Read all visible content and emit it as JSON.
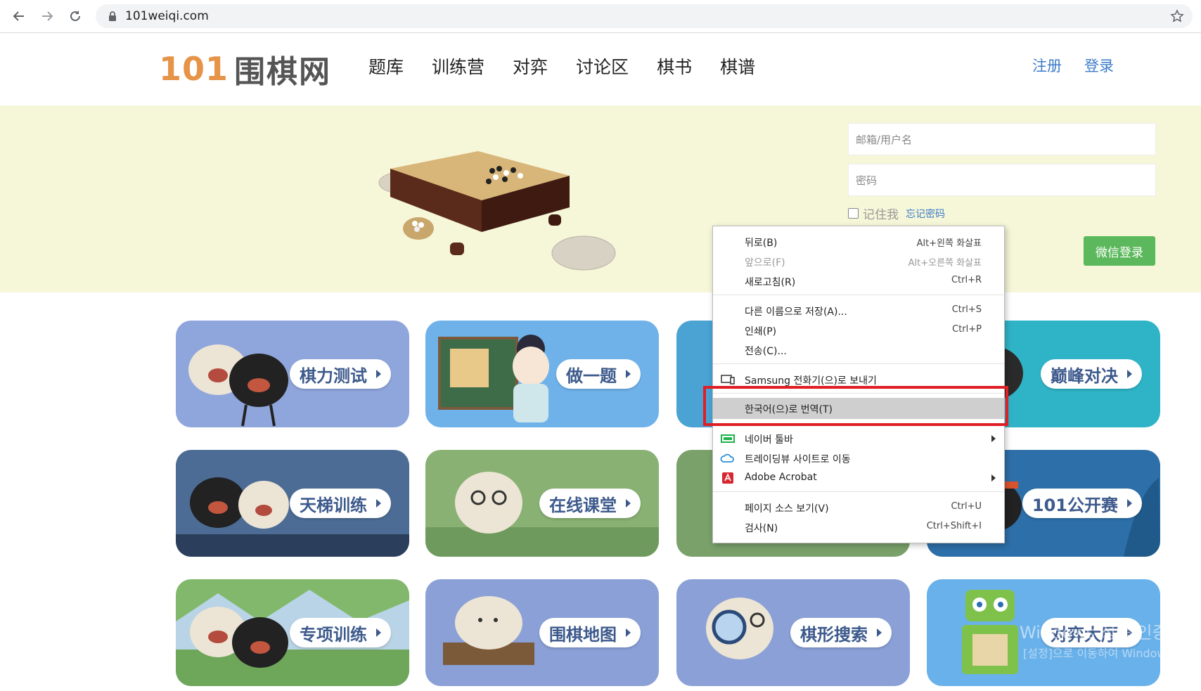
{
  "browser": {
    "url": "101weiqi.com"
  },
  "header": {
    "logo_number": "101",
    "logo_text": "围棋网",
    "nav": [
      "题库",
      "训练营",
      "对弈",
      "讨论区",
      "棋书",
      "棋谱"
    ],
    "register": "注册",
    "login": "登录"
  },
  "login": {
    "username_placeholder": "邮箱/用户名",
    "password_placeholder": "密码",
    "remember": "记住我",
    "forgot": "忘记密码",
    "wechat_login": "微信登录"
  },
  "cards": [
    {
      "label": "棋力测试",
      "color": "#8fa6dc"
    },
    {
      "label": "做一题",
      "color": "#6fb2ea"
    },
    {
      "label": "",
      "color": "#4aa3d3"
    },
    {
      "label": "巅峰对决",
      "color": "#2fb4c7"
    },
    {
      "label": "天梯训练",
      "color": "#4c6c95"
    },
    {
      "label": "在线课堂",
      "color": "#88b173"
    },
    {
      "label": "",
      "color": "#7aa16a"
    },
    {
      "label": "101公开赛",
      "color": "#2d6fa8"
    },
    {
      "label": "专项训练",
      "color": "#82b86b"
    },
    {
      "label": "围棋地图",
      "color": "#8aa0d6"
    },
    {
      "label": "棋形搜索",
      "color": "#8aa0d6"
    },
    {
      "label": "对弈大厅",
      "color": "#69b1ea"
    }
  ],
  "context_menu": {
    "back": {
      "label": "뒤로(B)",
      "shortcut": "Alt+왼쪽 화살표"
    },
    "forward": {
      "label": "앞으로(F)",
      "shortcut": "Alt+오른쪽 화살표"
    },
    "reload": {
      "label": "새로고침(R)",
      "shortcut": "Ctrl+R"
    },
    "save_as": {
      "label": "다른 이름으로 저장(A)...",
      "shortcut": "Ctrl+S"
    },
    "print": {
      "label": "인쇄(P)",
      "shortcut": "Ctrl+P"
    },
    "cast": {
      "label": "전송(C)..."
    },
    "samsung": {
      "label": "Samsung 전화기(으)로 보내기"
    },
    "translate": {
      "label": "한국어(으)로 번역(T)"
    },
    "naver_toolbar": {
      "label": "네이버 툴바"
    },
    "tradingview": {
      "label": "트레이딩뷰 사이트로 이동"
    },
    "acrobat": {
      "label": "Adobe Acrobat"
    },
    "view_source": {
      "label": "페이지 소스 보기(V)",
      "shortcut": "Ctrl+U"
    },
    "inspect": {
      "label": "검사(N)",
      "shortcut": "Ctrl+Shift+I"
    }
  },
  "watermark": {
    "line1": "Windows 정품 인증",
    "line2": "[설정]으로 이동하여 Windows를"
  }
}
